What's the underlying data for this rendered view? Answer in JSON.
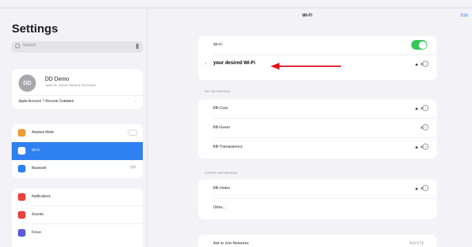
{
  "app": {
    "nav_title": "Wi-Fi",
    "edit_label": "Edit"
  },
  "sidebar": {
    "title": "Settings",
    "search_placeholder": "Search",
    "profile": {
      "initials": "DD",
      "name": "DD Demo",
      "subtitle": "Apple ID, iCloud, Media & Purchases",
      "extra": "Apple Account: 7 Records Outdated"
    },
    "group1": [
      {
        "label": "Airplane Mode",
        "icon": "airplane-icon",
        "color": "#f09a37"
      },
      {
        "label": "Wi-Fi",
        "icon": "wifi-icon",
        "color": "#ffffff",
        "selected": true
      },
      {
        "label": "Bluetooth",
        "icon": "bluetooth-icon",
        "color": "#2f80f0",
        "trail": "On"
      }
    ],
    "group2": [
      {
        "label": "Notifications",
        "icon": "notifications-icon",
        "color": "#e9413d"
      },
      {
        "label": "Sounds",
        "icon": "sounds-icon",
        "color": "#e9413d"
      },
      {
        "label": "Focus",
        "icon": "focus-icon",
        "color": "#5b5bd6"
      }
    ]
  },
  "wifi": {
    "toggle_label": "Wi-Fi",
    "toggle_on": true,
    "current_network": "your desired Wi-Fi",
    "my_networks_header": "MY NETWORKS",
    "my_networks": [
      "BB-Corp",
      "BB-Guest",
      "BB-Transparency"
    ],
    "other_header": "OTHER NETWORKS",
    "other_networks": [
      "BB-Visitor",
      "Other..."
    ],
    "ask_to_join": "Ask to Join Networks",
    "ask_value": "Notify",
    "accent": "#34c759",
    "annotation_color": "#e0141e"
  }
}
